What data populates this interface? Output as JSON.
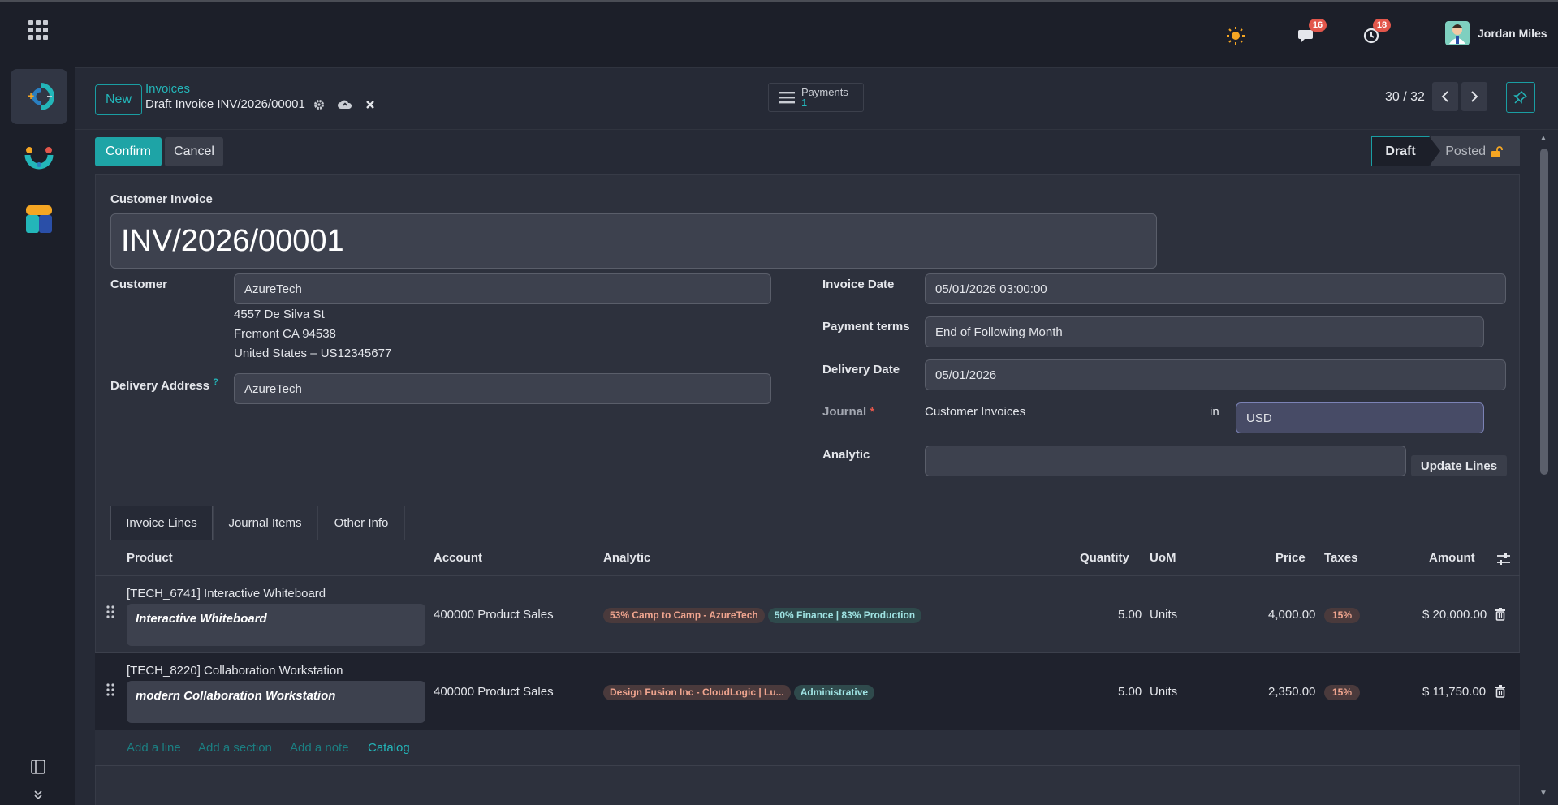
{
  "topbar": {
    "notifications": [
      {
        "icon": "chat-icon",
        "count": "16"
      },
      {
        "icon": "activity-clock-icon",
        "count": "18"
      }
    ],
    "user_name": "Jordan Miles"
  },
  "control_panel": {
    "new_label": "New",
    "breadcrumb": "Invoices",
    "record_title": "Draft Invoice INV/2026/00001",
    "payments_label": "Payments",
    "payments_count": "1",
    "pager": "30 / 32"
  },
  "actions": {
    "confirm_label": "Confirm",
    "cancel_label": "Cancel"
  },
  "status": {
    "draft": "Draft",
    "posted": "Posted"
  },
  "form": {
    "type_label": "Customer Invoice",
    "name": "INV/2026/00001",
    "customer_label": "Customer",
    "customer": "AzureTech",
    "address_line1": "4557 De Silva St",
    "address_line2": "Fremont CA 94538",
    "address_line3": "United States – US12345677",
    "delivery_address_label": "Delivery Address",
    "delivery_address_help": "?",
    "delivery_address": "AzureTech",
    "invoice_date_label": "Invoice Date",
    "invoice_date": "05/01/2026 03:00:00",
    "payment_terms_label": "Payment terms",
    "payment_terms": "End of Following Month",
    "delivery_date_label": "Delivery Date",
    "delivery_date": "05/01/2026",
    "journal_label": "Journal",
    "journal_required": "*",
    "journal": "Customer Invoices",
    "in_label": "in",
    "currency": "USD",
    "analytic_label": "Analytic",
    "analytic": "",
    "update_lines_label": "Update Lines"
  },
  "tabs": [
    "Invoice Lines",
    "Journal Items",
    "Other Info"
  ],
  "lines": {
    "headers": {
      "product": "Product",
      "account": "Account",
      "analytic": "Analytic",
      "quantity": "Quantity",
      "uom": "UoM",
      "price": "Price",
      "taxes": "Taxes",
      "amount": "Amount"
    },
    "rows": [
      {
        "product": "[TECH_6741] Interactive Whiteboard",
        "description": "Interactive Whiteboard",
        "account": "400000 Product Sales",
        "analytic_tags": [
          "53% Camp to Camp - AzureTech",
          "50% Finance | 83% Production"
        ],
        "quantity": "5.00",
        "uom": "Units",
        "price": "4,000.00",
        "tax": "15%",
        "amount": "$ 20,000.00"
      },
      {
        "product": "[TECH_8220] Collaboration Workstation",
        "description": "modern Collaboration Workstation",
        "account": "400000 Product Sales",
        "analytic_tags": [
          "Design Fusion Inc - CloudLogic | Lu...",
          "Administrative"
        ],
        "quantity": "5.00",
        "uom": "Units",
        "price": "2,350.00",
        "tax": "15%",
        "amount": "$ 11,750.00"
      }
    ],
    "add_line": "Add a line",
    "add_section": "Add a section",
    "add_note": "Add a note",
    "catalog": "Catalog"
  }
}
